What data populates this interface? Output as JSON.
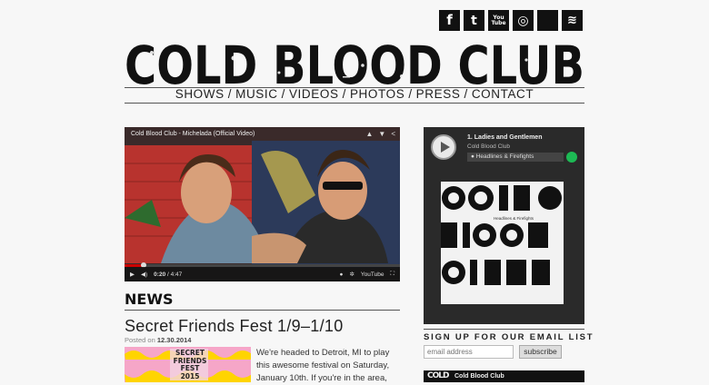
{
  "social": {
    "facebook": "f",
    "twitter": "t",
    "youtube": "You Tube",
    "instagram": "◎",
    "apple": "",
    "spotify": "≋"
  },
  "logo": {
    "text": "COLD BLOOD CLUB"
  },
  "nav": {
    "items": [
      "SHOWS",
      "MUSIC",
      "VIDEOS",
      "PHOTOS",
      "PRESS",
      "CONTACT"
    ],
    "separator": "/"
  },
  "video": {
    "title": "Cold Blood Club - Michelada (Official Video)",
    "time_current": "0:20",
    "time_total": "4:47",
    "played_fraction": 0.07,
    "brand": "YouTube"
  },
  "news": {
    "heading": "NEWS",
    "post": {
      "title": "Secret Friends Fest 1/9–1/10",
      "posted_label": "Posted on",
      "posted_date": "12.30.2014",
      "image_text": "SECRET FRIENDS FEST 2015",
      "excerpt": "We're headed to Detroit, MI to play this awesome festival on Saturday, January 10th. If you're in the area,"
    }
  },
  "player": {
    "track": "1. Ladies and Gentlemen",
    "artist": "Cold Blood Club",
    "album": "Headlines & Firefights",
    "cover_text": "COLD BLOOD CLUB",
    "cover_small": "Headlines & Firefights"
  },
  "signup": {
    "label": "SIGN UP FOR OUR EMAIL LIST",
    "placeholder": "email address",
    "button": "subscribe"
  },
  "widget": {
    "logo": "COLD",
    "name": "Cold Blood Club"
  },
  "colors": {
    "background": "#f7f7f7",
    "text": "#222222",
    "spotify": "#1db954",
    "progress": "#cc0000"
  }
}
